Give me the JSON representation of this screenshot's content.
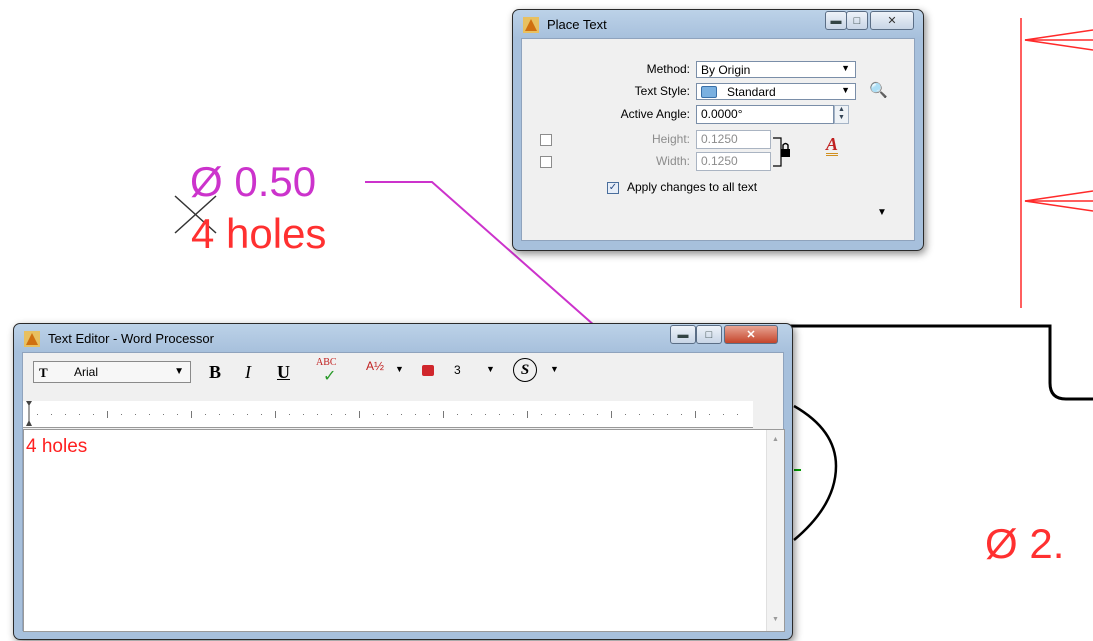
{
  "drawing": {
    "dimension_text": "Ø 0.50",
    "holes_text": "4 holes",
    "diameter_partial": "Ø 2."
  },
  "place_text": {
    "title": "Place Text",
    "method_label": "Method:",
    "method_value": "By Origin",
    "text_style_label": "Text Style:",
    "text_style_value": "Standard",
    "active_angle_label": "Active Angle:",
    "active_angle_value": "0.0000°",
    "height_label": "Height:",
    "height_value": "0.1250",
    "width_label": "Width:",
    "width_value": "0.1250",
    "apply_changes_label": "Apply changes to all text",
    "apply_changes_checked": true
  },
  "text_editor": {
    "title": "Text Editor - Word Processor",
    "font_name": "Arial",
    "bold_label": "B",
    "italic_label": "I",
    "underline_label": "U",
    "spell_label": "ABC",
    "color_index": "3",
    "content": "4 holes"
  },
  "colors": {
    "magenta": "#cc33cc",
    "red_text": "#ff3030",
    "red_line": "#ff2a2a",
    "dialog_frame": "#a7c0dc"
  }
}
